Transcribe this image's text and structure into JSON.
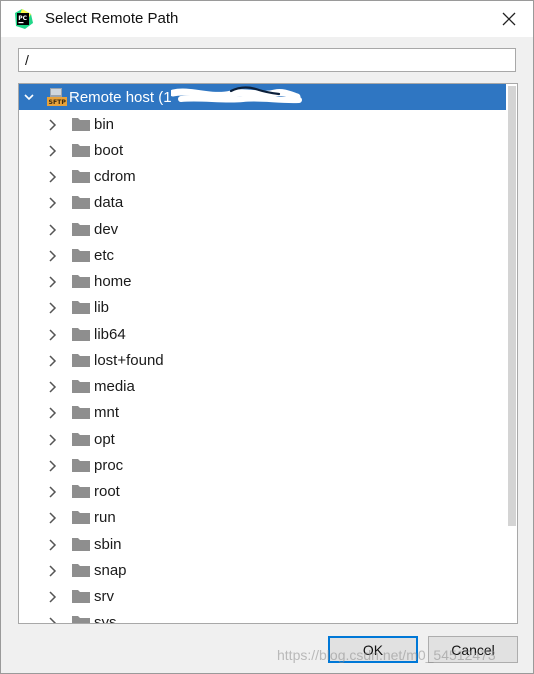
{
  "window": {
    "title": "Select Remote Path",
    "app_icon": "pycharm-icon",
    "close_icon": "close-icon"
  },
  "path_input": {
    "value": "/"
  },
  "tree": {
    "root": {
      "label": "Remote host (1",
      "icon": "sftp-icon",
      "expanded": true,
      "selected": true,
      "selection_color": "#2f76c2"
    },
    "items": [
      {
        "label": "bin"
      },
      {
        "label": "boot"
      },
      {
        "label": "cdrom"
      },
      {
        "label": "data"
      },
      {
        "label": "dev"
      },
      {
        "label": "etc"
      },
      {
        "label": "home"
      },
      {
        "label": "lib"
      },
      {
        "label": "lib64"
      },
      {
        "label": "lost+found"
      },
      {
        "label": "media"
      },
      {
        "label": "mnt"
      },
      {
        "label": "opt"
      },
      {
        "label": "proc"
      },
      {
        "label": "root"
      },
      {
        "label": "run"
      },
      {
        "label": "sbin"
      },
      {
        "label": "snap"
      },
      {
        "label": "srv"
      },
      {
        "label": "sys"
      }
    ],
    "item_icon": "folder-icon",
    "collapsed_icon": "chevron-right-icon"
  },
  "buttons": {
    "ok_label": "OK",
    "cancel_label": "Cancel"
  },
  "watermark": "https://blog.csdn.net/m0_54512473",
  "colors": {
    "accent": "#0078d7",
    "folder": "#8e8e8e"
  }
}
